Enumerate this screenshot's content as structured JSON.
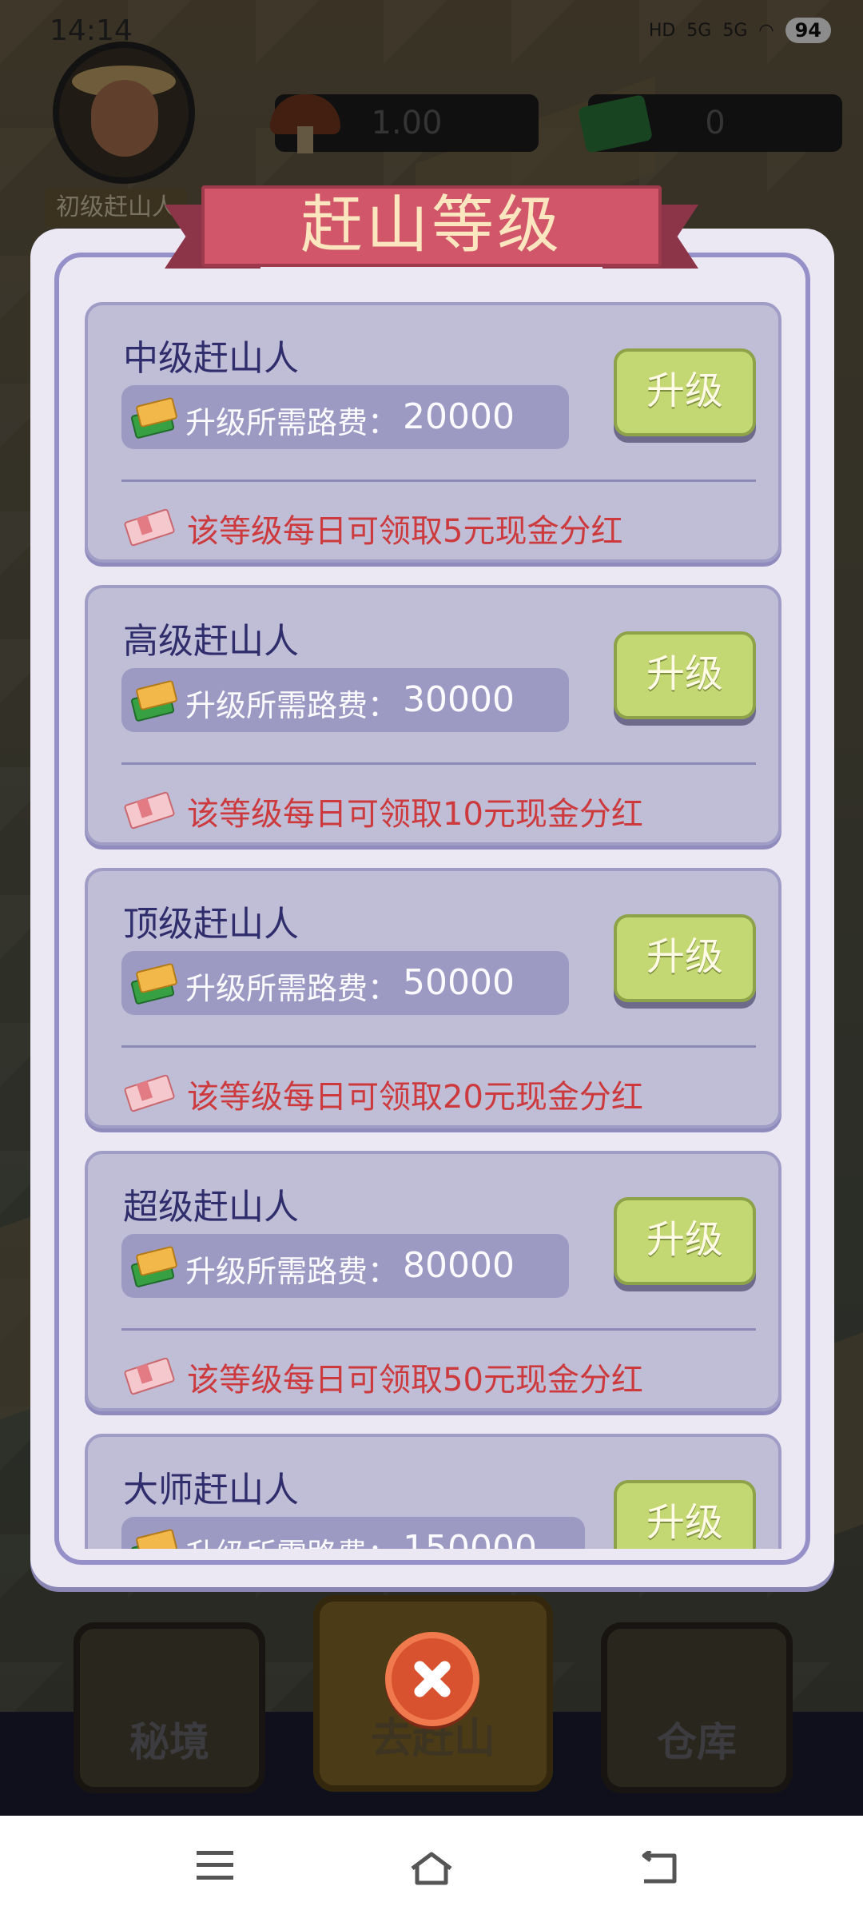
{
  "status_bar": {
    "time": "14:14",
    "signal_1": "5G",
    "signal_2": "5G",
    "battery": "94",
    "hd": "HD"
  },
  "hud": {
    "rank_label": "初级赶山人",
    "mushroom_count": "1.00",
    "cash_count": "0"
  },
  "modal": {
    "title": "赶山等级",
    "fee_label": "升级所需路费：",
    "upgrade_label": "升级",
    "levels": [
      {
        "name": "中级赶山人",
        "fee": "20000",
        "bonus": "该等级每日可领取5元现金分红"
      },
      {
        "name": "高级赶山人",
        "fee": "30000",
        "bonus": "该等级每日可领取10元现金分红"
      },
      {
        "name": "顶级赶山人",
        "fee": "50000",
        "bonus": "该等级每日可领取20元现金分红"
      },
      {
        "name": "超级赶山人",
        "fee": "80000",
        "bonus": "该等级每日可领取50元现金分红"
      },
      {
        "name": "大师赶山人",
        "fee": "150000",
        "bonus": ""
      }
    ]
  },
  "bottom_nav": {
    "left": "秘境",
    "center": "去赶山",
    "right": "仓库"
  },
  "colors": {
    "ribbon": "#d2566a",
    "upgrade_button": "#c3d873",
    "card": "#c0bdd6",
    "bonus_text": "#cc3a3e",
    "close_button": "#d8522f"
  }
}
